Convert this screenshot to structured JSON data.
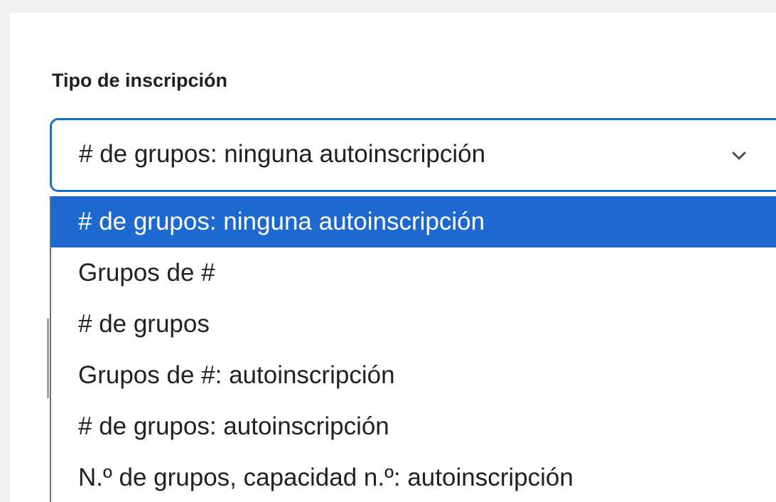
{
  "field": {
    "label": "Tipo de inscripción",
    "selected_value": "# de grupos: ninguna autoinscripción",
    "chevron_icon": "chevron-down-icon",
    "accent_color": "#1a6fc4"
  },
  "dropdown": {
    "highlight_color": "#1d69d0",
    "options": [
      {
        "label": "# de grupos: ninguna autoinscripción",
        "selected": true
      },
      {
        "label": "Grupos de #",
        "selected": false
      },
      {
        "label": "# de grupos",
        "selected": false
      },
      {
        "label": "Grupos de #: autoinscripción",
        "selected": false
      },
      {
        "label": "# de grupos: autoinscripción",
        "selected": false
      },
      {
        "label": "N.º de grupos, capacidad n.º: autoinscripción",
        "selected": false
      }
    ]
  }
}
